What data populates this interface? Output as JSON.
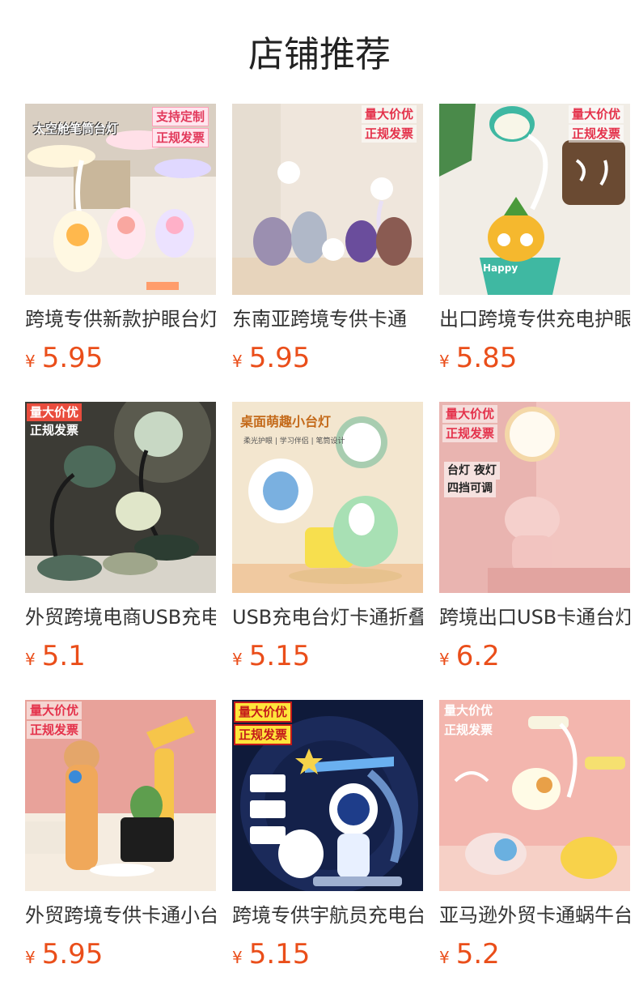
{
  "header": {
    "title": "店铺推荐"
  },
  "currency_symbol": "¥",
  "products": [
    {
      "name": "跨境专供新款护眼台灯",
      "price": "5.95",
      "badges": [
        "支持定制",
        "正规发票"
      ],
      "image_text": "太空舱笔筒台灯"
    },
    {
      "name": "东南亚跨境专供卡通",
      "price": "5.95",
      "badges": [
        "量大价优",
        "正规发票"
      ]
    },
    {
      "name": "出口跨境专供充电护眼",
      "price": "5.85",
      "badges": [
        "量大价优",
        "正规发票"
      ],
      "image_text": "Happy"
    },
    {
      "name": "外贸跨境电商USB充电",
      "price": "5.1",
      "badges": [
        "量大价优",
        "正规发票"
      ]
    },
    {
      "name": "USB充电台灯卡通折叠",
      "price": "5.15",
      "badges": [],
      "image_text": "桌面萌趣小台灯",
      "image_subtext": "柔光护眼 | 学习伴侣 | 笔筒设计"
    },
    {
      "name": "跨境出口USB卡通台灯",
      "price": "6.2",
      "badges": [
        "量大价优",
        "正规发票"
      ],
      "image_text": "台灯 夜灯",
      "image_subtext": "四挡可调"
    },
    {
      "name": "外贸跨境专供卡通小台灯",
      "price": "5.95",
      "badges": [
        "量大价优",
        "正规发票"
      ]
    },
    {
      "name": "跨境专供宇航员充电台灯",
      "price": "5.15",
      "badges": [
        "量大价优",
        "正规发票"
      ]
    },
    {
      "name": "亚马逊外贸卡通蜗牛台灯",
      "price": "5.2",
      "badges": [
        "量大价优",
        "正规发票"
      ]
    }
  ]
}
